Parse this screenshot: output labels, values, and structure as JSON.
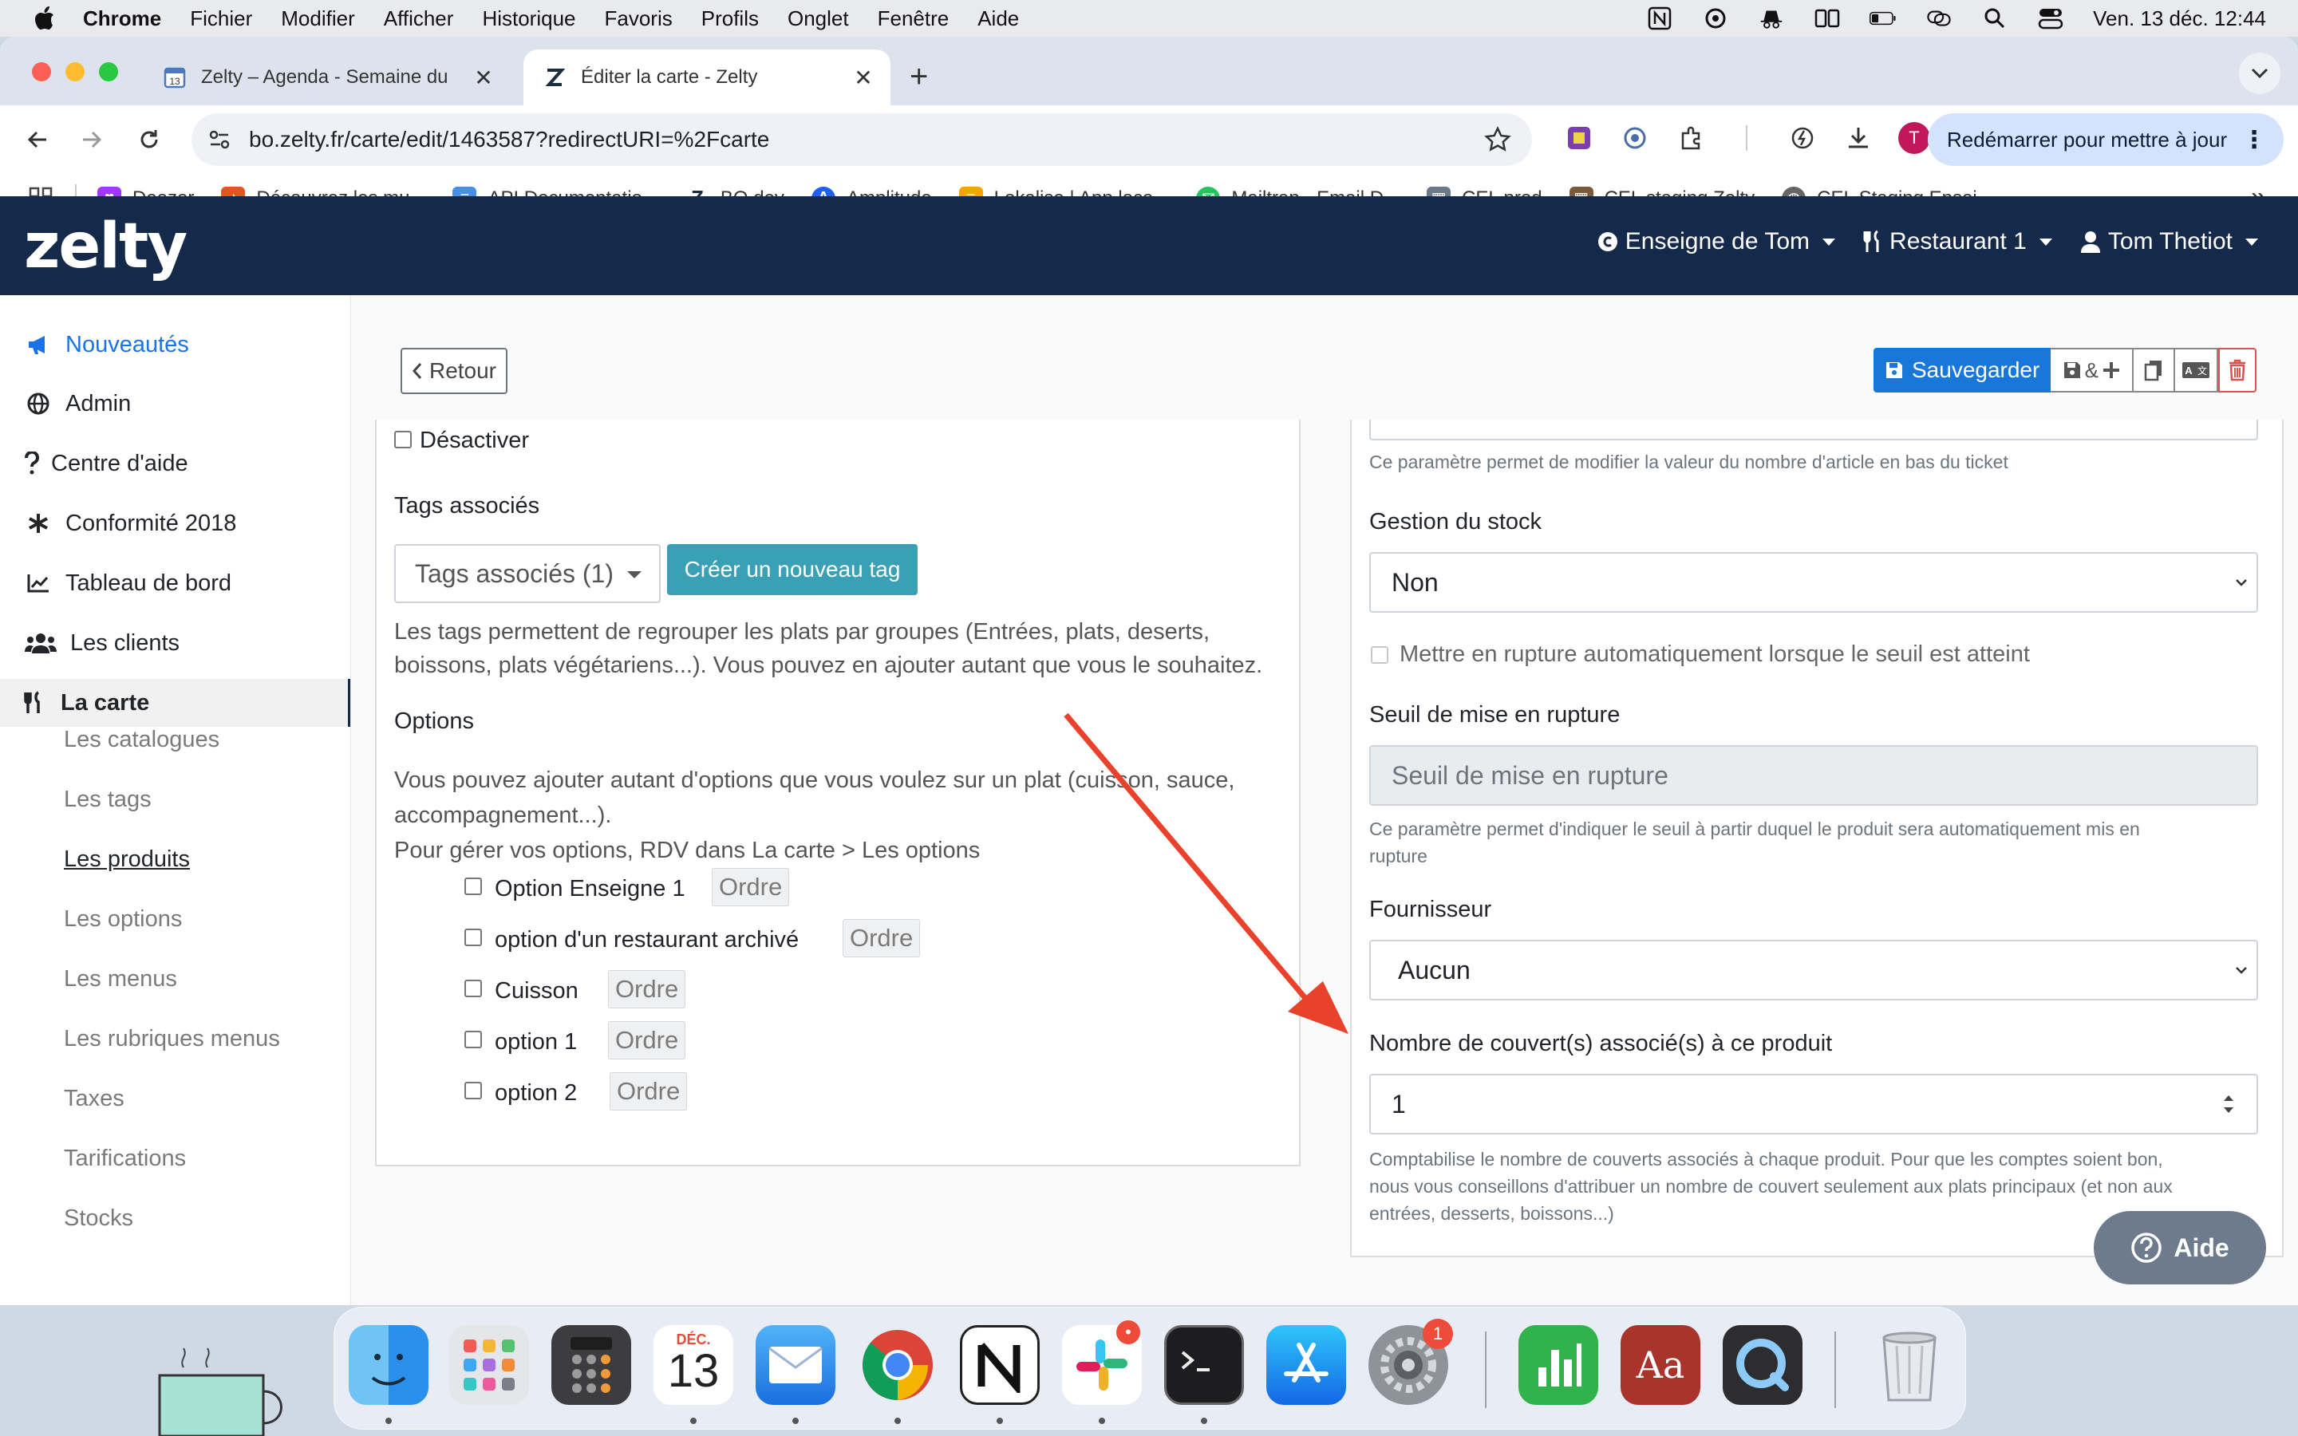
{
  "menubar": {
    "app": "Chrome",
    "items": [
      "Fichier",
      "Modifier",
      "Afficher",
      "Historique",
      "Favoris",
      "Profils",
      "Onglet",
      "Fenêtre",
      "Aide"
    ],
    "clock": "Ven. 13 déc.  12:44"
  },
  "browser": {
    "tabs": [
      {
        "title": "Zelty – Agenda - Semaine du"
      },
      {
        "title": "Éditer la carte - Zelty"
      }
    ],
    "url": "bo.zelty.fr/carte/edit/1463587?redirectURI=%2Fcarte",
    "update_button": "Redémarrer pour mettre à jour",
    "profile_initial": "T",
    "bookmarks": [
      {
        "label": "Deezer",
        "color": "#a238ff"
      },
      {
        "label": "Découvrez les mu...",
        "color": "#e4551f"
      },
      {
        "label": "API Documentatio...",
        "color": "#4a90e2"
      },
      {
        "label": "BO dev",
        "color": "#2b2b2b"
      },
      {
        "label": "Amplitude",
        "color": "#1e61f0"
      },
      {
        "label": "Lokalise | App loca...",
        "color": "#f0a500"
      },
      {
        "label": "Mailtrap - Email D...",
        "color": "#22c55e"
      },
      {
        "label": "CEL prod",
        "color": "#6b7a8a"
      },
      {
        "label": "CEL staging Zelty",
        "color": "#7a5a3a"
      },
      {
        "label": "CEL Staging Ensei...",
        "color": "#666666"
      }
    ],
    "bookmarks_more": "»"
  },
  "app": {
    "logo": "zelty",
    "nav": {
      "brand": "Enseigne de Tom",
      "restaurant": "Restaurant 1",
      "user": "Tom Thetiot"
    },
    "sidebar": {
      "items": [
        {
          "label": "Nouveautés",
          "icon": "megaphone-icon"
        },
        {
          "label": "Admin",
          "icon": "globe-icon"
        },
        {
          "label": "Centre d'aide",
          "icon": "question-icon"
        },
        {
          "label": "Conformité 2018",
          "icon": "asterisk-icon"
        },
        {
          "label": "Tableau de bord",
          "icon": "chart-icon"
        },
        {
          "label": "Les clients",
          "icon": "users-icon"
        },
        {
          "label": "La carte",
          "icon": "utensils-icon"
        }
      ],
      "subitems": [
        "Les catalogues",
        "Les tags",
        "Les produits",
        "Les options",
        "Les menus",
        "Les rubriques menus",
        "Taxes",
        "Tarifications",
        "Stocks"
      ]
    },
    "actions": {
      "back": "Retour",
      "save": "Sauvegarder",
      "save_and_new": "&"
    },
    "left": {
      "disable_label": "Désactiver",
      "tags_heading": "Tags associés",
      "tags_select": "Tags associés (1)",
      "new_tag_button": "Créer un nouveau tag",
      "tags_help_1": "Les tags permettent de regrouper les plats par groupes (Entrées, plats, deserts,",
      "tags_help_2": "boissons, plats végétariens...). Vous pouvez en ajouter autant que vous le souhaitez.",
      "options_heading": "Options",
      "options_help_1": "Vous pouvez ajouter autant d'options que vous voulez sur un plat (cuisson, sauce,",
      "options_help_2": "accompagnement...).",
      "options_help_3": "Pour gérer vos options, RDV dans La carte > Les options",
      "options": [
        {
          "label": "Option Enseigne 1",
          "order": "Ordre"
        },
        {
          "label": "option d'un restaurant archivé",
          "order": "Ordre"
        },
        {
          "label": "Cuisson",
          "order": "Ordre"
        },
        {
          "label": "option 1",
          "order": "Ordre"
        },
        {
          "label": "option 2",
          "order": "Ordre"
        }
      ]
    },
    "right": {
      "ticket_help": "Ce paramètre permet de modifier la valeur du nombre d'article en bas du ticket",
      "stock_label": "Gestion du stock",
      "stock_value": "Non",
      "auto_rupture_label": "Mettre en rupture automatiquement lorsque le seuil est atteint",
      "threshold_label": "Seuil de mise en rupture",
      "threshold_placeholder": "Seuil de mise en rupture",
      "threshold_help_1": "Ce paramètre permet d'indiquer le seuil à partir duquel le produit sera automatiquement mis en",
      "threshold_help_2": "rupture",
      "supplier_label": "Fournisseur",
      "supplier_value": "Aucun",
      "covers_label": "Nombre de couvert(s) associé(s) à ce produit",
      "covers_value": "1",
      "covers_help_1": "Comptabilise le nombre de couverts associés à chaque produit. Pour que les comptes soient bon,",
      "covers_help_2": "nous vous conseillons d'attribuer un nombre de couvert seulement aux plats principaux (et non aux",
      "covers_help_3": "entrées, desserts, boissons...)"
    },
    "help_button": "Aide"
  },
  "dock": {
    "apps": [
      "finder-icon",
      "launchpad-icon",
      "calculator-icon",
      "calendar-icon",
      "mail-icon",
      "chrome-icon",
      "notion-icon",
      "slack-icon",
      "terminal-icon",
      "app-store-icon",
      "system-settings-icon",
      "numbers-icon",
      "dictionary-icon",
      "quicktime-icon",
      "trash-icon"
    ],
    "calendar_month": "DÉC.",
    "calendar_day": "13",
    "settings_badge": "1"
  },
  "colors": {
    "navbar": "#15294a",
    "primary": "#1877d9",
    "teal_button": "#3aa0b5",
    "annotation_arrow": "#e8412c",
    "danger": "#d9534f"
  }
}
